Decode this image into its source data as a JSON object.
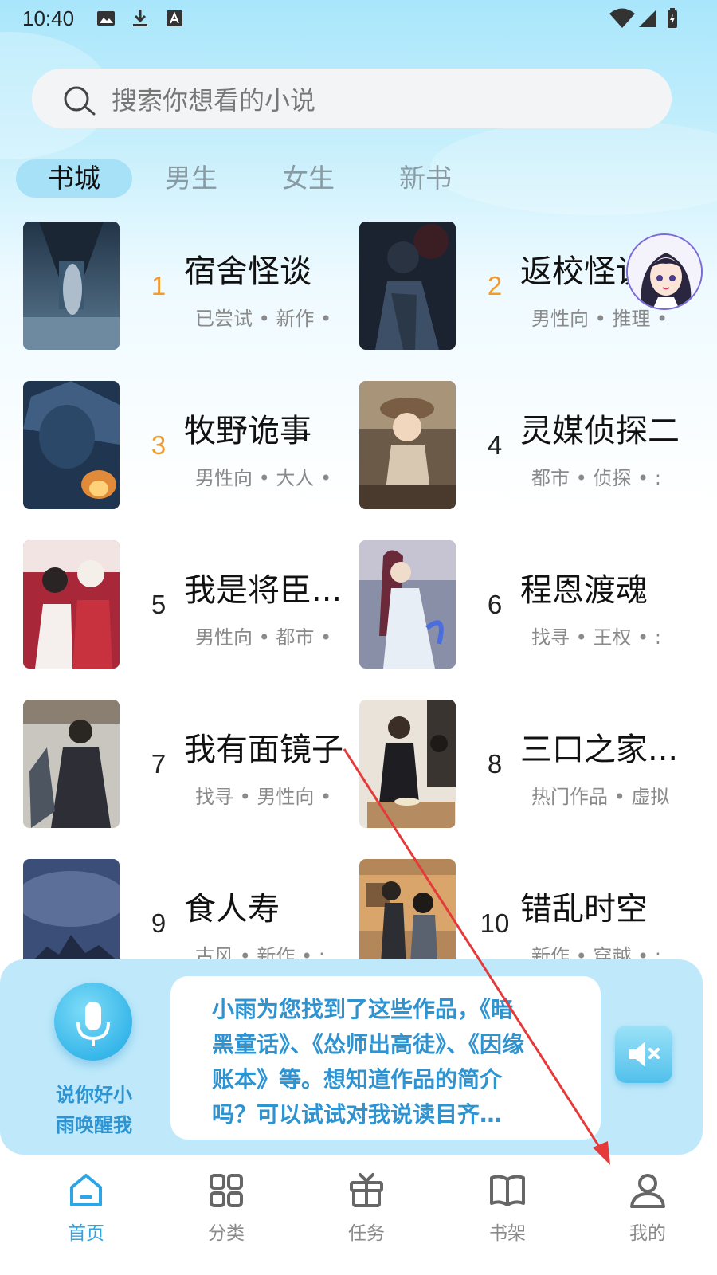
{
  "status_bar": {
    "time": "10:40",
    "left_icons": [
      "image-icon",
      "download-icon",
      "font-icon"
    ],
    "right_icons": [
      "wifi-icon",
      "signal-icon",
      "battery-icon"
    ]
  },
  "search": {
    "placeholder": "搜索你想看的小说"
  },
  "tabs": [
    {
      "label": "书城",
      "active": true
    },
    {
      "label": "男生",
      "active": false
    },
    {
      "label": "女生",
      "active": false
    },
    {
      "label": "新书",
      "active": false
    }
  ],
  "books": [
    {
      "rank": "1",
      "title": "宿舍怪谈",
      "tags": "已尝试 • 新作 •"
    },
    {
      "rank": "2",
      "title": "返校怪谈",
      "tags": "男性向 • 推理 •"
    },
    {
      "rank": "3",
      "title": "牧野诡事",
      "tags": "男性向 • 大人 •"
    },
    {
      "rank": "4",
      "title": "灵媒侦探二",
      "tags": "都市 • 侦探 • :"
    },
    {
      "rank": "5",
      "title": "我是将臣...",
      "tags": "男性向 • 都市 •"
    },
    {
      "rank": "6",
      "title": "程恩渡魂",
      "tags": "找寻 • 王权 • :"
    },
    {
      "rank": "7",
      "title": "我有面镜子",
      "tags": "找寻 • 男性向 •"
    },
    {
      "rank": "8",
      "title": "三口之家...",
      "tags": "热门作品 • 虚拟"
    },
    {
      "rank": "9",
      "title": "食人寿",
      "tags": "古风 • 新作 • :"
    },
    {
      "rank": "10",
      "title": "错乱时空",
      "tags": "新作 • 穿越 • :"
    }
  ],
  "assistant": {
    "wake_hint": "说你好小雨唤醒我",
    "message": "小雨为您找到了这些作品，《暗黑童话》、《怂师出高徒》、《因缘账本》等。想知道作品的简介吗？可以试试对我说读目齐…"
  },
  "bottom_nav": [
    {
      "label": "首页",
      "icon": "home-icon",
      "active": true
    },
    {
      "label": "分类",
      "icon": "grid-icon",
      "active": false
    },
    {
      "label": "任务",
      "icon": "gift-icon",
      "active": false
    },
    {
      "label": "书架",
      "icon": "book-icon",
      "active": false
    },
    {
      "label": "我的",
      "icon": "profile-icon",
      "active": false
    }
  ],
  "colors": {
    "accent": "#2ea6e6",
    "rank_hot": "#f39a2c",
    "annotation_arrow": "#e5393a"
  }
}
